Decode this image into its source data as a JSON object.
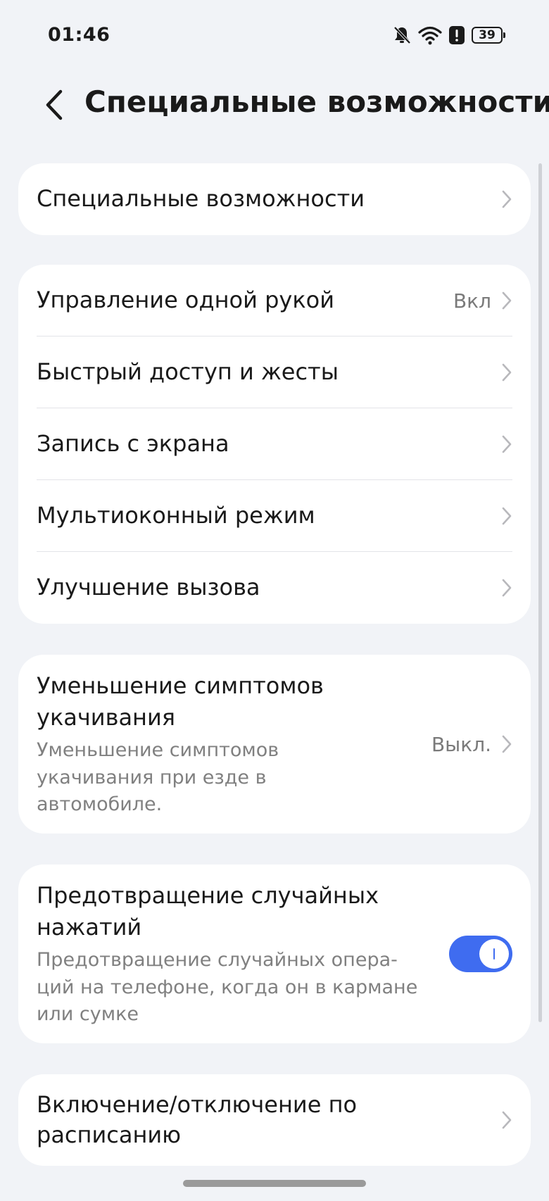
{
  "status_bar": {
    "time": "01:46",
    "battery": "39",
    "icons": [
      "bell-off-icon",
      "wifi-icon",
      "alert-icon",
      "battery-icon"
    ]
  },
  "header": {
    "title": "Специальные возможности",
    "back_icon": "chevron-left-icon"
  },
  "groups": {
    "g1": {
      "items": [
        {
          "label": "Специальные возможности"
        }
      ]
    },
    "g2": {
      "items": [
        {
          "label": "Управление одной рукой",
          "value": "Вкл"
        },
        {
          "label": "Быстрый доступ и жесты"
        },
        {
          "label": "Запись с экрана"
        },
        {
          "label": "Мультиоконный режим"
        },
        {
          "label": "Улучшение вызова"
        }
      ]
    },
    "g3": {
      "title": "Уменьшение симптомов укачивания",
      "subtitle": "Уменьшение симптомов укачивания при езде в автомобиле.",
      "value": "Выкл."
    },
    "g4": {
      "title": "Предотвращение случайных нажатий",
      "subtitle": "Предотвращение случайных опера-ций на телефоне, когда он в кармане или сумке",
      "toggle_on": true
    },
    "g5": {
      "title": "Включение/отключение по расписанию"
    }
  },
  "colors": {
    "background": "#f1f3f7",
    "card": "#ffffff",
    "accent": "#3f6cf0",
    "secondary_text": "#808080"
  }
}
